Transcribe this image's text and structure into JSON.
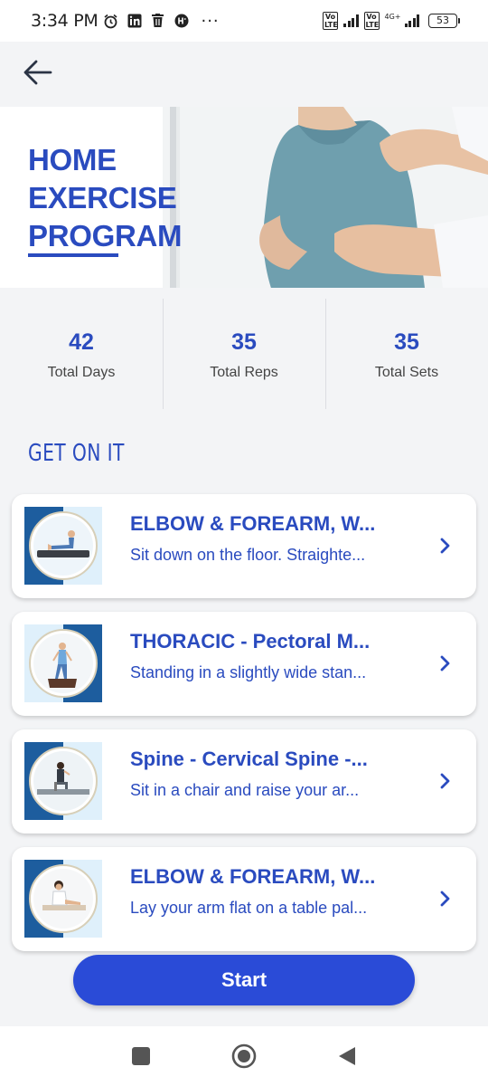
{
  "status_bar": {
    "time": "3:34 PM",
    "dots": "···",
    "volte_1": "Vo LTE",
    "volte_2": "Vo LTE",
    "network": "4G+",
    "battery": "53",
    "icons": [
      "alarm-icon",
      "linkedin-icon",
      "trash-icon",
      "app-icon"
    ]
  },
  "header": {
    "back_icon": "back-arrow-icon"
  },
  "hero": {
    "title_line1": "HOME",
    "title_line2": "EXERCISE",
    "title_line3": "PROGRAM"
  },
  "stats": [
    {
      "value": "42",
      "label": "Total Days"
    },
    {
      "value": "35",
      "label": "Total Reps"
    },
    {
      "value": "35",
      "label": "Total Sets"
    }
  ],
  "section_title": "GET ON IT",
  "exercises": [
    {
      "title": "ELBOW & FOREARM, W...",
      "description": "Sit down on the floor. Straighte..."
    },
    {
      "title": "THORACIC - Pectoral M...",
      "description": "Standing in a slightly wide stan..."
    },
    {
      "title": "Spine - Cervical Spine -...",
      "description": "Sit in a chair and raise your ar..."
    },
    {
      "title": "ELBOW & FOREARM, W...",
      "description": "Lay your arm flat on a table pal..."
    }
  ],
  "start_label": "Start",
  "colors": {
    "accent": "#2a4bbf",
    "button": "#2a4bd7",
    "background": "#f3f4f6"
  }
}
